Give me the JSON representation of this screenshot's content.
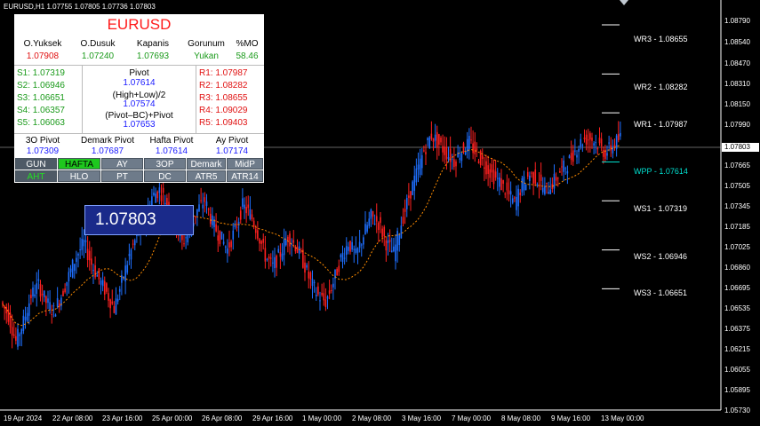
{
  "header": {
    "info": "EURUSD,H1  1.07755 1.07805 1.07736 1.07803"
  },
  "panel": {
    "symbol": "EURUSD",
    "stats_headers": [
      "O.Yuksek",
      "O.Dusuk",
      "Kapanis",
      "Gorunum",
      "%MO"
    ],
    "stats_values": [
      "1.07908",
      "1.07240",
      "1.07693",
      "Yukan",
      "58.46"
    ],
    "supports": [
      "S1: 1.07319",
      "S2: 1.06946",
      "S3: 1.06651",
      "S4: 1.06357",
      "S5: 1.06063"
    ],
    "resistances": [
      "R1: 1.07987",
      "R2: 1.08282",
      "R3: 1.08655",
      "R4: 1.09029",
      "R5: 1.09403"
    ],
    "pivot_label": "Pivot",
    "pivot_value": "1.07614",
    "formula1_label": "(High+Low)/2",
    "formula1_value": "1.07574",
    "formula2_label": "(Pivot–BC)+Pivot",
    "formula2_value": "1.07653",
    "bottom_headers": [
      "3O Pivot",
      "Demark Pivot",
      "Hafta Pivot",
      "Ay Pivot"
    ],
    "bottom_values": [
      "1.07309",
      "1.07687",
      "1.07614",
      "1.07174"
    ],
    "buttons_row1": [
      "GUN",
      "HAFTA",
      "AY",
      "3OP",
      "Demark",
      "MidP"
    ],
    "buttons_row2": [
      "AHT",
      "HLO",
      "PT",
      "DC",
      "ATR5",
      "ATR14"
    ],
    "active_button": "HAFTA"
  },
  "price_box": "1.07803",
  "current_price_tag": "1.07803",
  "pivot_levels": [
    {
      "label": "WR3 - 1.08655",
      "value": 1.08655,
      "color": "#ffffff"
    },
    {
      "label": "WR2 - 1.08282",
      "value": 1.08282,
      "color": "#ffffff"
    },
    {
      "label": "WR1 - 1.07987",
      "value": 1.07987,
      "color": "#ffffff"
    },
    {
      "label": "WPP - 1.07614",
      "value": 1.07614,
      "color": "#00e0d0"
    },
    {
      "label": "WS1 - 1.07319",
      "value": 1.07319,
      "color": "#ffffff"
    },
    {
      "label": "WS2 - 1.06946",
      "value": 1.06946,
      "color": "#ffffff"
    },
    {
      "label": "WS3 - 1.06651",
      "value": 1.06651,
      "color": "#ffffff"
    }
  ],
  "price_axis": [
    "1.08790",
    "1.08540",
    "1.08470",
    "1.08310",
    "1.08150",
    "1.07990",
    "1.07803",
    "1.07665",
    "1.07505",
    "1.07345",
    "1.07185",
    "1.07025",
    "1.06860",
    "1.06695",
    "1.06535",
    "1.06375",
    "1.06215",
    "1.06055",
    "1.05895",
    "1.05730"
  ],
  "time_axis": [
    "19 Apr 2024",
    "22 Apr 08:00",
    "23 Apr 16:00",
    "25 Apr 00:00",
    "26 Apr 08:00",
    "29 Apr 16:00",
    "1 May 00:00",
    "2 May 08:00",
    "3 May 16:00",
    "7 May 00:00",
    "8 May 08:00",
    "9 May 16:00",
    "13 May 00:00"
  ],
  "colors": {
    "bull": "#1e6fff",
    "bear": "#ff2020",
    "ma": "#ff8c00",
    "grid_line": "#ffffff"
  },
  "chart_data": {
    "type": "candlestick",
    "ylim": [
      1.0573,
      1.0879
    ],
    "close_series": [
      1.0655,
      1.0645,
      1.0625,
      1.064,
      1.066,
      1.0668,
      1.0655,
      1.0648,
      1.066,
      1.0675,
      1.069,
      1.07,
      1.0684,
      1.0672,
      1.0662,
      1.065,
      1.067,
      1.069,
      1.0705,
      1.072,
      1.0735,
      1.074,
      1.073,
      1.0715,
      1.07,
      1.071,
      1.0725,
      1.0732,
      1.0715,
      1.0705,
      1.0695,
      1.071,
      1.0728,
      1.0722,
      1.0708,
      1.069,
      1.0682,
      1.0692,
      1.0705,
      1.0698,
      1.0686,
      1.067,
      1.066,
      1.0655,
      1.067,
      1.0688,
      1.07,
      1.069,
      1.0706,
      1.072,
      1.0715,
      1.07,
      1.0692,
      1.0715,
      1.0735,
      1.0752,
      1.077,
      1.0782,
      1.0775,
      1.0768,
      1.0762,
      1.077,
      1.0776,
      1.0767,
      1.076,
      1.0752,
      1.0746,
      1.0738,
      1.073,
      1.0744,
      1.0752,
      1.0748,
      1.074,
      1.0745,
      1.0754,
      1.076,
      1.077,
      1.0778,
      1.078,
      1.0775,
      1.0768,
      1.0774,
      1.078
    ]
  }
}
